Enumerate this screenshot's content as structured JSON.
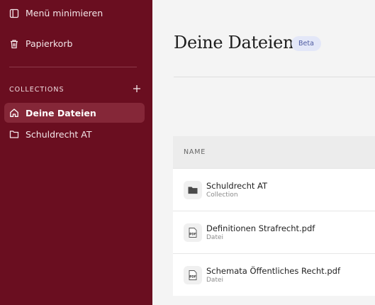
{
  "sidebar": {
    "minimize_label": "Menü minimieren",
    "trash_label": "Papierkorb",
    "collections_label": "COLLECTIONS",
    "nav": [
      {
        "label": "Deine Dateien",
        "active": true
      },
      {
        "label": "Schuldrecht AT",
        "active": false
      }
    ]
  },
  "main": {
    "title": "Deine Dateien",
    "badge": "Beta",
    "table": {
      "header_name": "NAME",
      "rows": [
        {
          "name": "Schuldrecht AT",
          "type": "Collection",
          "icon": "folder-icon"
        },
        {
          "name": "Definitionen Strafrecht.pdf",
          "type": "Datei",
          "icon": "pdf-icon"
        },
        {
          "name": "Schemata Öffentliches Recht.pdf",
          "type": "Datei",
          "icon": "pdf-icon"
        }
      ]
    }
  },
  "colors": {
    "sidebar_bg": "#6a0e20",
    "active_item": "#852738",
    "page_bg": "#f4f4f4",
    "badge_bg": "#e3e7f8"
  }
}
